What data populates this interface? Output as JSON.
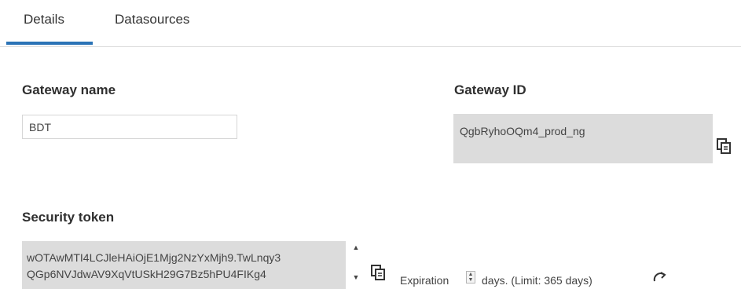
{
  "tabs": [
    {
      "label": "Details",
      "active": true
    },
    {
      "label": "Datasources",
      "active": false
    }
  ],
  "accent_color": "#2b73b6",
  "gateway_name": {
    "label": "Gateway name",
    "value": "BDT"
  },
  "gateway_id": {
    "label": "Gateway ID",
    "value": "QgbRyhoOQm4_prod_ng",
    "copy_icon": "copy-icon"
  },
  "security_token": {
    "label": "Security token",
    "line1": "wOTAwMTI4LCJleHAiOjE1Mjg2NzYxMjh9.TwLnqy3",
    "line2": "QGp6NVJdwAV9XqVtUSkH29G7Bz5hPU4FIKg4",
    "copy_icon": "copy-icon"
  },
  "expiration": {
    "label": "Expiration",
    "limit_text": "days. (Limit: 365 days)",
    "refresh_icon": "refresh-icon"
  }
}
